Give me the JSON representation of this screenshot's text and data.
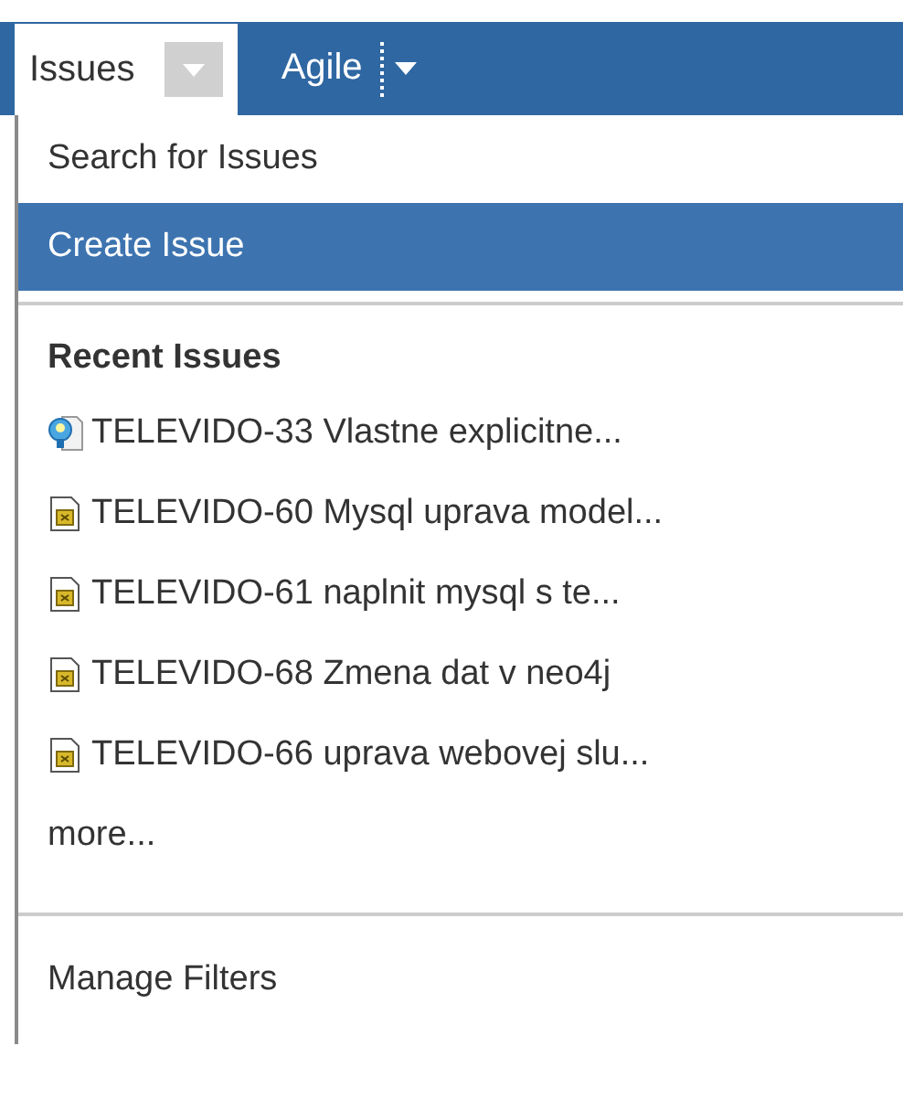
{
  "tabs": [
    {
      "label": "Issues",
      "selected": true
    },
    {
      "label": "Agile",
      "selected": false
    }
  ],
  "menu": {
    "items": [
      {
        "label": "Search for Issues",
        "selected": false
      },
      {
        "label": "Create Issue",
        "selected": true
      }
    ],
    "recent": {
      "heading": "Recent Issues",
      "issues": [
        {
          "kind": "idea",
          "text": "TELEVIDO-33 Vlastne explicitne..."
        },
        {
          "kind": "task",
          "text": "TELEVIDO-60 Mysql uprava model..."
        },
        {
          "kind": "task",
          "text": "TELEVIDO-61 naplnit mysql s te..."
        },
        {
          "kind": "task",
          "text": "TELEVIDO-68 Zmena dat v neo4j"
        },
        {
          "kind": "task",
          "text": "TELEVIDO-66 uprava webovej slu..."
        }
      ],
      "more": "more..."
    },
    "footer": "Manage Filters"
  }
}
